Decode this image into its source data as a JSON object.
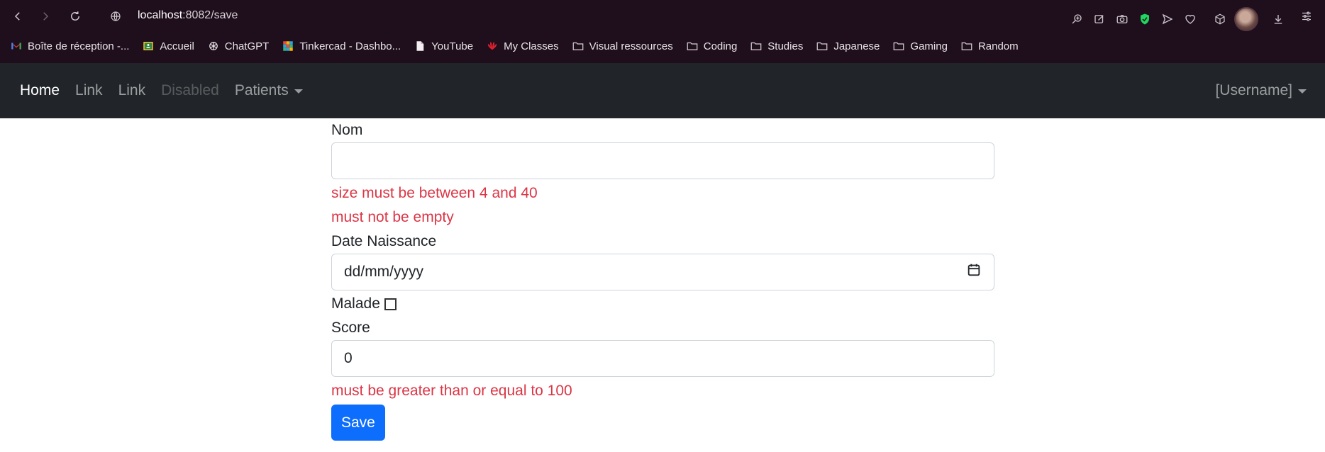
{
  "browser": {
    "url_host": "localhost",
    "url_path": ":8082/save",
    "bookmarks": [
      {
        "label": "Boîte de réception -...",
        "icon": "gmail-icon"
      },
      {
        "label": "Accueil",
        "icon": "classroom-icon"
      },
      {
        "label": "ChatGPT",
        "icon": "chatgpt-icon"
      },
      {
        "label": "Tinkercad - Dashbo...",
        "icon": "tinkercad-icon"
      },
      {
        "label": "YouTube",
        "icon": "page-icon"
      },
      {
        "label": "My Classes",
        "icon": "huawei-icon"
      },
      {
        "label": "Visual ressources",
        "icon": "folder-icon"
      },
      {
        "label": "Coding",
        "icon": "folder-icon"
      },
      {
        "label": "Studies",
        "icon": "folder-icon"
      },
      {
        "label": "Japanese",
        "icon": "folder-icon"
      },
      {
        "label": "Gaming",
        "icon": "folder-icon"
      },
      {
        "label": "Random",
        "icon": "folder-icon"
      }
    ]
  },
  "navbar": {
    "home": "Home",
    "link1": "Link",
    "link2": "Link",
    "disabled": "Disabled",
    "patients": "Patients",
    "username": "[Username]"
  },
  "form": {
    "nom_label": "Nom",
    "nom_value": "",
    "nom_error1": "size must be between 4 and 40",
    "nom_error2": "must not be empty",
    "date_label": "Date Naissance",
    "date_placeholder": "dd/mm/yyyy",
    "malade_label": "Malade",
    "score_label": "Score",
    "score_value": "0",
    "score_error": "must be greater than or equal to 100",
    "save_label": "Save"
  },
  "colors": {
    "chrome_bg": "#1f0f1d",
    "navbar_bg": "#212529",
    "error": "#dc3545",
    "primary": "#0d6efd"
  }
}
